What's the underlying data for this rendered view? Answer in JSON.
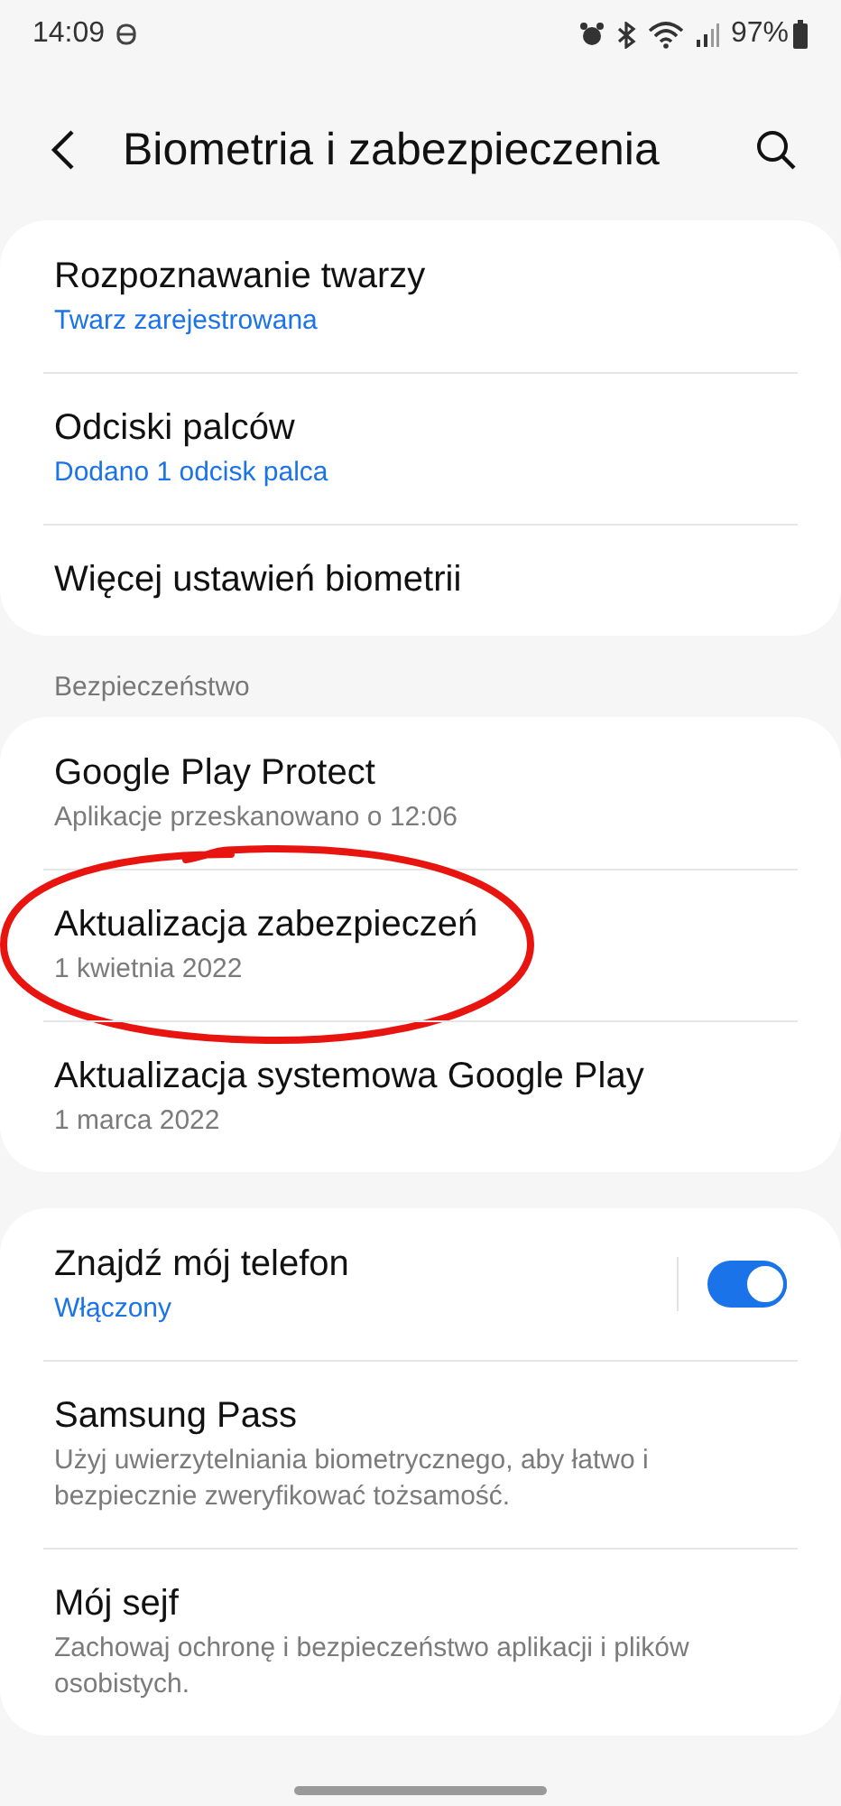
{
  "status_bar": {
    "time": "14:09",
    "battery": "97%"
  },
  "header": {
    "title": "Biometria i zabezpieczenia"
  },
  "groups": [
    {
      "items": [
        {
          "kind": "plain",
          "title": "Rozpoznawanie twarzy",
          "subtitle": "Twarz zarejestrowana",
          "accent": true,
          "circled": false
        },
        {
          "kind": "plain",
          "title": "Odciski palców",
          "subtitle": "Dodano 1 odcisk palca",
          "accent": true,
          "circled": false
        },
        {
          "kind": "plain",
          "title": "Więcej ustawień biometrii",
          "circled": false
        }
      ]
    },
    {
      "label": "Bezpieczeństwo",
      "items": [
        {
          "kind": "plain",
          "title": "Google Play Protect",
          "subtitle": "Aplikacje przeskanowano o 12:06",
          "accent": false,
          "circled": false
        },
        {
          "kind": "plain",
          "title": "Aktualizacja zabezpieczeń",
          "subtitle": "1 kwietnia 2022",
          "accent": false,
          "circled": true
        },
        {
          "kind": "plain",
          "title": "Aktualizacja systemowa Google Play",
          "subtitle": "1 marca 2022",
          "accent": false,
          "circled": false
        }
      ]
    },
    {
      "items": [
        {
          "kind": "toggle",
          "title": "Znajdź mój telefon",
          "subtitle": "Włączony",
          "accent": true,
          "on": true,
          "circled": false
        },
        {
          "kind": "plain",
          "title": "Samsung Pass",
          "subtitle": "Użyj uwierzytelniania biometrycznego, aby łatwo i bezpiecznie zweryfikować tożsamość.",
          "accent": false,
          "circled": false
        },
        {
          "kind": "plain",
          "title": "Mój sejf",
          "subtitle": "Zachowaj ochronę i bezpieczeństwo aplikacji i plików osobistych.",
          "accent": false,
          "circled": false
        }
      ]
    }
  ]
}
